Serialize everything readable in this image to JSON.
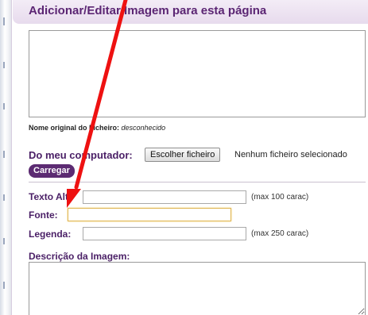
{
  "dialog": {
    "title": "Adicionar/Editar Imagem para esta página",
    "original_filename_label": "Nome original do Ficheiro:",
    "original_filename_value": "desconhecido",
    "from_computer_label": "Do meu computador:",
    "choose_file_button": "Escolher ficheiro",
    "no_file_selected": "Nenhum ficheiro selecionado",
    "upload_button": "Carregar",
    "alt_text_label": "Texto Alt:",
    "alt_text_value": "",
    "alt_text_hint": "(max 100 carac)",
    "source_label": "Fonte:",
    "source_value": "",
    "caption_label": "Legenda:",
    "caption_value": "",
    "caption_hint": "(max 250 carac)",
    "description_label": "Descrição da Imagem:"
  },
  "colors": {
    "label_purple": "#4a1f66",
    "title_purple": "#5b2573",
    "button_purple": "#5c2b72",
    "focus_border": "#e0b652",
    "annotation_arrow": "#ee1111"
  }
}
